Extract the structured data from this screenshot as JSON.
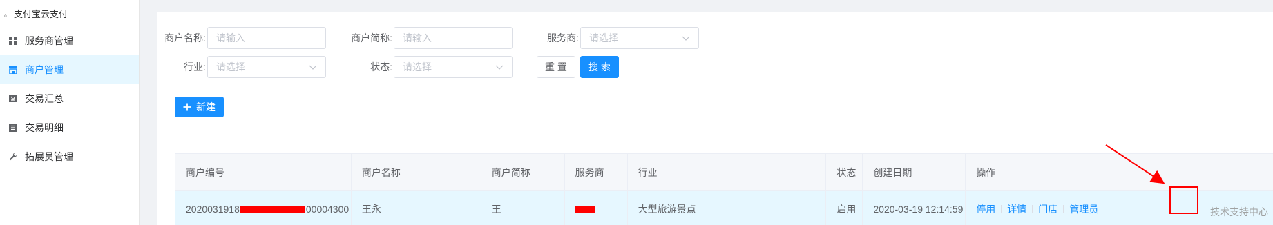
{
  "sidebar": {
    "brand": "支付宝云支付",
    "items": [
      {
        "label": "服务商管理",
        "icon": "grid-icon"
      },
      {
        "label": "商户管理",
        "icon": "store-icon",
        "active": true
      },
      {
        "label": "交易汇总",
        "icon": "summary-icon"
      },
      {
        "label": "交易明细",
        "icon": "detail-icon"
      },
      {
        "label": "拓展员管理",
        "icon": "wrench-icon"
      }
    ]
  },
  "filters": {
    "merchant_name_label": "商户名称:",
    "merchant_name_placeholder": "请输入",
    "merchant_short_label": "商户简称:",
    "merchant_short_placeholder": "请输入",
    "provider_label": "服务商:",
    "provider_placeholder": "请选择",
    "industry_label": "行业:",
    "industry_placeholder": "请选择",
    "status_label": "状态:",
    "status_placeholder": "请选择",
    "reset_label": "重 置",
    "search_label": "搜 索"
  },
  "toolbar": {
    "new_label": "新建"
  },
  "table": {
    "headers": [
      "商户编号",
      "商户名称",
      "商户简称",
      "服务商",
      "行业",
      "状态",
      "创建日期",
      "操作"
    ],
    "rows": [
      {
        "id_prefix": "2020031918",
        "id_suffix": "00004300",
        "name": "王永",
        "short": "王",
        "provider": "",
        "industry": "大型旅游景点",
        "status": "启用",
        "created": "2020-03-19 12:14:59",
        "ops": [
          "停用",
          "详情",
          "门店",
          "管理员"
        ]
      }
    ]
  },
  "watermark": "技术支持中心",
  "colors": {
    "accent": "#1890ff",
    "annotation": "#ff0000",
    "active_bg": "#e6f7ff"
  }
}
